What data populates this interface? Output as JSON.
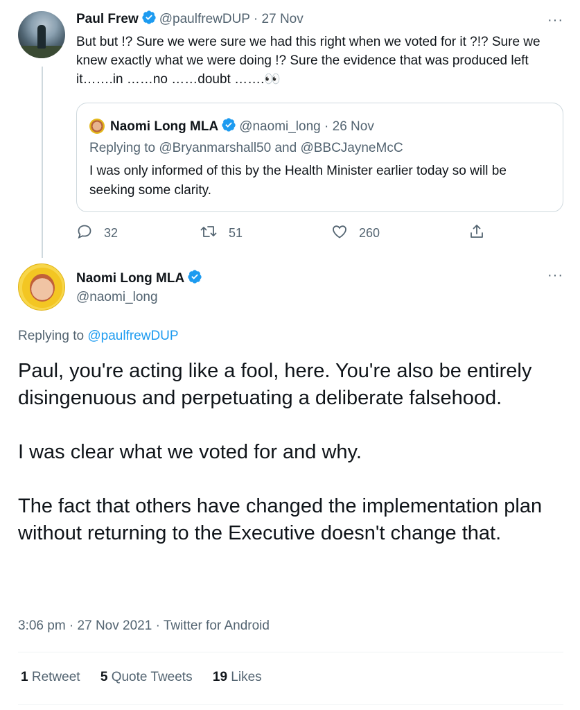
{
  "parent_tweet": {
    "name": "Paul Frew",
    "handle": "@paulfrewDUP",
    "date": "· 27 Nov",
    "text": "But but !? Sure we were sure we had this right when we voted for it ?!? Sure we knew exactly what we were doing !? Sure the evidence that was produced left it…….in ……no ……doubt …….👀",
    "avatar_icon": "person-hiking-photo",
    "more_label": "···"
  },
  "quoted_tweet": {
    "name": "Naomi Long MLA",
    "handle": "@naomi_long",
    "date": "· 26 Nov",
    "replying_to": "Replying to @Bryanmarshall50 and @BBCJayneMcC",
    "text": "I was only informed of this by the Health Minister earlier today so will be seeking some clarity."
  },
  "actions": {
    "reply_count": "32",
    "retweet_count": "51",
    "like_count": "260"
  },
  "main_tweet": {
    "name": "Naomi Long MLA",
    "handle": "@naomi_long",
    "more_label": "···",
    "replying_prefix": "Replying to ",
    "replying_handle": "@paulfrewDUP",
    "paragraph_1": "Paul, you're acting like a fool, here. You're also be entirely disingenuous and perpetuating a deliberate falsehood.",
    "paragraph_2": "I was clear what we voted for and why.",
    "paragraph_3": "The fact that others have changed the implementation plan without returning to the Executive doesn't change that.",
    "meta": "3:06 pm · 27 Nov 2021 · Twitter for Android"
  },
  "stats": {
    "retweets_count": "1",
    "retweets_label": " Retweet",
    "quotes_count": "5",
    "quotes_label": " Quote Tweets",
    "likes_count": "19",
    "likes_label": " Likes"
  },
  "colors": {
    "verified": "#1d9bf0",
    "link": "#1d9bf0",
    "muted": "#536471",
    "border": "#cfd9de"
  }
}
